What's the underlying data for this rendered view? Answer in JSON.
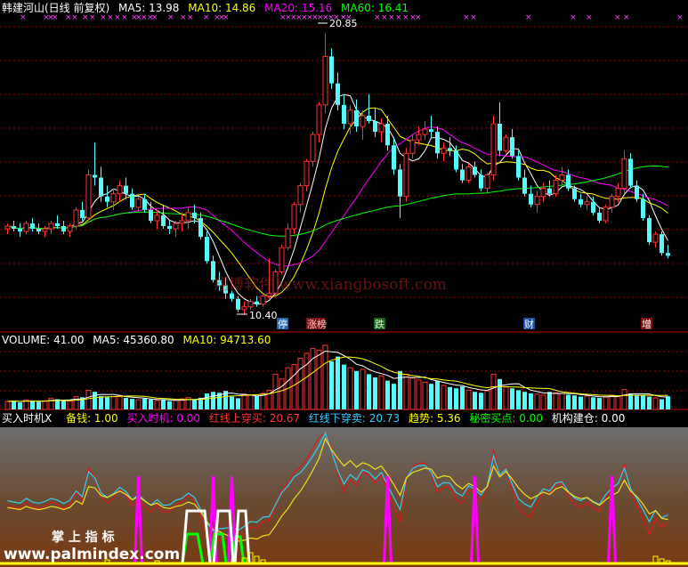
{
  "stock": {
    "title": "韩建河山(日线 前复权)",
    "ma5_label": "MA5: 13.98",
    "ma10_label": "MA10: 14.86",
    "ma20_label": "MA20: 15.16",
    "ma60_label": "MA60: 16.41",
    "high_label": "20.85",
    "low_label": "10.40",
    "watermark": "翔博软件 www.xiangbosoft.com",
    "event_tags": [
      "停",
      "涨榜",
      "跌",
      "财",
      "增"
    ]
  },
  "volume": {
    "title": "VOLUME: 41.00",
    "ma5_label": "MA5: 45360.80",
    "ma10_label": "MA10: 94713.60"
  },
  "indicator": {
    "title": "买入时机X",
    "items": [
      {
        "label": "备钱: 1.00",
        "color": "#ffff00"
      },
      {
        "label": "买入时机: 0.00",
        "color": "#ff00ff"
      },
      {
        "label": "红线上穿买: 20.67",
        "color": "#ff3333"
      },
      {
        "label": "红线下穿卖: 20.73",
        "color": "#33ccff"
      },
      {
        "label": "趋势: 5.36",
        "color": "#ffff00"
      },
      {
        "label": "秘密买点: 0.00",
        "color": "#00ff00"
      },
      {
        "label": "机构建仓: 0.00",
        "color": "#ffffff"
      }
    ],
    "brand_cn": "掌 上 指 标",
    "brand_url": "www.palmindex.com"
  },
  "colors": {
    "up": "#ff3232",
    "down": "#54fcfc",
    "ma5": "#ffffff",
    "ma10": "#ffff00",
    "ma20": "#ff00ff",
    "ma60": "#00ff00",
    "grid": "#a00000"
  },
  "chart_data": [
    {
      "type": "candlestick",
      "title": "韩建河山(日线 前复权)",
      "ylim": [
        9.8,
        21.5
      ],
      "high": 20.85,
      "low": 10.4,
      "grid": true,
      "candles": [
        [
          13.6,
          13.8,
          13.4,
          13.7
        ],
        [
          13.7,
          13.9,
          13.5,
          13.6
        ],
        [
          13.6,
          13.8,
          13.3,
          13.5
        ],
        [
          13.5,
          13.9,
          13.4,
          13.8
        ],
        [
          13.8,
          14.0,
          13.5,
          13.6
        ],
        [
          13.6,
          13.8,
          13.4,
          13.5
        ],
        [
          13.5,
          13.7,
          13.3,
          13.6
        ],
        [
          13.6,
          13.9,
          13.4,
          13.8
        ],
        [
          13.8,
          14.1,
          13.6,
          13.7
        ],
        [
          13.7,
          13.9,
          13.4,
          13.5
        ],
        [
          13.5,
          13.8,
          13.3,
          13.7
        ],
        [
          13.7,
          14.4,
          13.6,
          14.3
        ],
        [
          14.3,
          14.6,
          13.9,
          14.0
        ],
        [
          14.0,
          15.8,
          13.9,
          15.6
        ],
        [
          15.6,
          16.8,
          15.2,
          15.5
        ],
        [
          15.5,
          15.9,
          14.6,
          14.8
        ],
        [
          14.8,
          15.2,
          14.4,
          14.6
        ],
        [
          14.6,
          15.1,
          14.3,
          14.9
        ],
        [
          14.9,
          15.4,
          14.6,
          15.2
        ],
        [
          15.2,
          15.5,
          14.7,
          14.9
        ],
        [
          14.9,
          15.1,
          14.3,
          14.4
        ],
        [
          14.4,
          14.8,
          14.2,
          14.7
        ],
        [
          14.7,
          14.9,
          14.2,
          14.3
        ],
        [
          14.3,
          14.6,
          13.8,
          13.9
        ],
        [
          13.9,
          14.3,
          13.6,
          14.1
        ],
        [
          14.1,
          14.5,
          13.6,
          13.7
        ],
        [
          13.7,
          13.9,
          13.4,
          13.6
        ],
        [
          13.6,
          13.9,
          13.3,
          13.8
        ],
        [
          13.8,
          14.2,
          13.5,
          13.9
        ],
        [
          13.9,
          14.4,
          13.6,
          14.2
        ],
        [
          14.2,
          14.5,
          13.8,
          14.0
        ],
        [
          14.0,
          14.2,
          13.2,
          13.3
        ],
        [
          13.3,
          13.5,
          12.3,
          12.4
        ],
        [
          12.4,
          12.6,
          11.6,
          11.7
        ],
        [
          11.7,
          12.0,
          11.3,
          11.5
        ],
        [
          11.5,
          11.8,
          11.0,
          11.2
        ],
        [
          11.2,
          11.3,
          10.9,
          11.0
        ],
        [
          11.0,
          11.1,
          10.5,
          10.6
        ],
        [
          10.6,
          10.9,
          10.4,
          10.7
        ],
        [
          10.7,
          11.0,
          10.6,
          10.9
        ],
        [
          10.9,
          11.1,
          10.7,
          10.8
        ],
        [
          10.8,
          11.2,
          10.7,
          11.1
        ],
        [
          11.1,
          12.5,
          11.0,
          11.2
        ],
        [
          11.2,
          12.1,
          11.1,
          12.0
        ],
        [
          12.0,
          13.0,
          11.9,
          12.9
        ],
        [
          12.9,
          13.8,
          12.8,
          13.6
        ],
        [
          13.6,
          14.6,
          13.4,
          14.5
        ],
        [
          14.5,
          15.3,
          14.2,
          15.2
        ],
        [
          15.2,
          16.2,
          15.0,
          16.1
        ],
        [
          16.1,
          17.2,
          15.9,
          17.1
        ],
        [
          17.1,
          18.3,
          16.8,
          18.2
        ],
        [
          18.2,
          20.85,
          17.9,
          20.0
        ],
        [
          20.0,
          20.3,
          18.8,
          19.0
        ],
        [
          19.0,
          19.4,
          18.0,
          18.2
        ],
        [
          18.2,
          18.6,
          17.3,
          17.5
        ],
        [
          17.5,
          18.2,
          17.1,
          18.0
        ],
        [
          18.0,
          18.4,
          17.2,
          17.4
        ],
        [
          17.4,
          18.0,
          16.9,
          17.8
        ],
        [
          17.8,
          18.6,
          17.5,
          17.6
        ],
        [
          17.6,
          18.1,
          17.0,
          17.2
        ],
        [
          17.2,
          17.7,
          16.8,
          17.5
        ],
        [
          17.5,
          17.8,
          16.5,
          16.7
        ],
        [
          16.7,
          17.0,
          15.6,
          15.8
        ],
        [
          15.8,
          16.0,
          14.0,
          14.8
        ],
        [
          14.8,
          16.6,
          14.6,
          16.4
        ],
        [
          16.4,
          17.1,
          16.2,
          16.9
        ],
        [
          16.9,
          17.4,
          16.7,
          17.1
        ],
        [
          17.1,
          17.6,
          16.9,
          17.3
        ],
        [
          17.3,
          17.8,
          17.0,
          17.2
        ],
        [
          17.2,
          17.4,
          16.2,
          16.4
        ],
        [
          16.4,
          16.8,
          16.1,
          16.6
        ],
        [
          16.6,
          17.0,
          16.3,
          16.5
        ],
        [
          16.5,
          16.7,
          15.7,
          15.8
        ],
        [
          15.8,
          16.0,
          15.3,
          15.4
        ],
        [
          15.4,
          16.0,
          15.3,
          15.9
        ],
        [
          15.9,
          16.1,
          15.5,
          15.6
        ],
        [
          15.6,
          15.8,
          15.0,
          15.1
        ],
        [
          15.1,
          15.7,
          14.9,
          15.6
        ],
        [
          15.6,
          17.8,
          15.4,
          17.5
        ],
        [
          17.5,
          18.3,
          16.3,
          16.5
        ],
        [
          16.5,
          17.1,
          16.4,
          17.0
        ],
        [
          17.0,
          17.3,
          16.2,
          16.3
        ],
        [
          16.3,
          16.5,
          15.4,
          15.5
        ],
        [
          15.5,
          15.8,
          14.8,
          14.9
        ],
        [
          14.9,
          15.2,
          14.4,
          14.5
        ],
        [
          14.5,
          15.0,
          14.2,
          14.8
        ],
        [
          14.8,
          15.3,
          14.6,
          15.1
        ],
        [
          15.1,
          15.4,
          14.8,
          14.9
        ],
        [
          14.9,
          15.6,
          14.8,
          15.4
        ],
        [
          15.4,
          15.9,
          15.2,
          15.6
        ],
        [
          15.6,
          15.8,
          15.0,
          15.1
        ],
        [
          15.1,
          15.2,
          14.6,
          14.7
        ],
        [
          14.7,
          14.9,
          14.4,
          14.5
        ],
        [
          14.5,
          14.8,
          14.3,
          14.6
        ],
        [
          14.6,
          14.8,
          14.1,
          14.2
        ],
        [
          14.2,
          14.4,
          13.8,
          13.9
        ],
        [
          13.9,
          14.5,
          13.8,
          14.4
        ],
        [
          14.4,
          14.9,
          14.2,
          14.8
        ],
        [
          14.8,
          15.3,
          14.6,
          15.1
        ],
        [
          15.1,
          16.5,
          14.9,
          16.2
        ],
        [
          16.2,
          16.4,
          15.1,
          15.2
        ],
        [
          15.2,
          15.4,
          14.6,
          14.7
        ],
        [
          14.7,
          14.9,
          13.9,
          14.0
        ],
        [
          14.0,
          14.1,
          13.0,
          13.1
        ],
        [
          13.1,
          13.5,
          12.9,
          13.4
        ],
        [
          13.4,
          13.5,
          12.6,
          12.7
        ],
        [
          12.7,
          13.0,
          12.5,
          12.6
        ]
      ],
      "series_names": [
        "MA5",
        "MA10",
        "MA20",
        "MA60"
      ]
    },
    {
      "type": "bar",
      "title": "VOLUME",
      "ylim": [
        0,
        200000
      ],
      "values": [
        25,
        28,
        22,
        30,
        26,
        24,
        27,
        35,
        32,
        28,
        26,
        40,
        38,
        60,
        55,
        42,
        38,
        40,
        44,
        36,
        33,
        30,
        34,
        31,
        28,
        30,
        26,
        28,
        33,
        37,
        31,
        36,
        50,
        55,
        52,
        58,
        40,
        35,
        48,
        45,
        42,
        50,
        60,
        110,
        95,
        130,
        140,
        160,
        175,
        190,
        185,
        200,
        150,
        165,
        140,
        130,
        120,
        125,
        110,
        100,
        105,
        90,
        80,
        120,
        110,
        98,
        92,
        85,
        80,
        90,
        75,
        70,
        66,
        72,
        60,
        55,
        52,
        58,
        110,
        95,
        70,
        66,
        60,
        55,
        50,
        48,
        45,
        55,
        52,
        50,
        46,
        44,
        40,
        42,
        38,
        36,
        40,
        45,
        42,
        62,
        50,
        46,
        44,
        40,
        36,
        32,
        41
      ]
    },
    {
      "type": "line",
      "title": "买入时机X",
      "ylim": [
        0,
        100
      ],
      "series_names": [
        "红线上穿买",
        "红线下穿卖",
        "趋势"
      ]
    }
  ]
}
